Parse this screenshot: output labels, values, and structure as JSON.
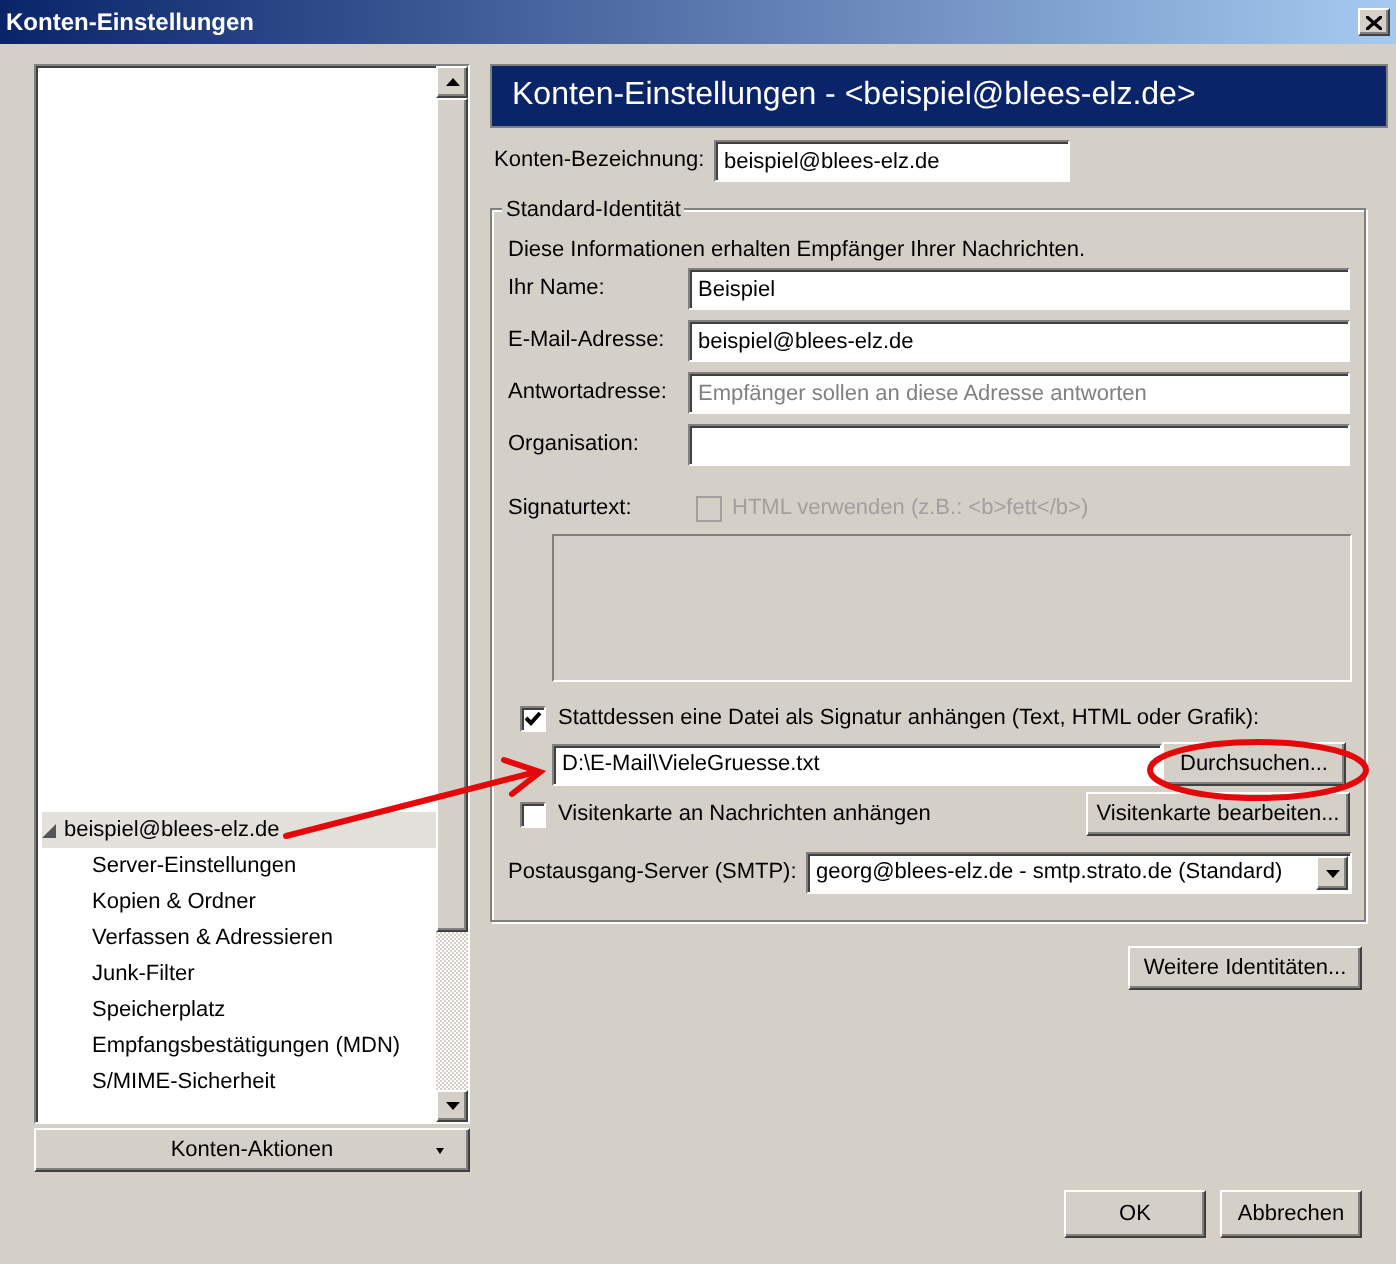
{
  "window": {
    "title": "Konten-Einstellungen"
  },
  "tree": {
    "items": [
      {
        "label": "beispiel@blees-elz.de",
        "selected": true,
        "expanded": true,
        "children": [
          {
            "label": "Server-Einstellungen",
            "selected": false
          },
          {
            "label": "Kopien & Ordner",
            "selected": false
          },
          {
            "label": "Verfassen & Adressieren",
            "selected": false
          },
          {
            "label": "Junk-Filter",
            "selected": false
          },
          {
            "label": "Speicherplatz",
            "selected": false
          },
          {
            "label": "Empfangsbestätigungen (MDN)",
            "selected": false
          },
          {
            "label": "S/MIME-Sicherheit",
            "selected": false
          }
        ]
      }
    ]
  },
  "account_actions_button": "Konten-Aktionen",
  "header": "Konten-Einstellungen - <beispiel@blees-elz.de>",
  "account_name": {
    "label": "Konten-Bezeichnung:",
    "value": "beispiel@blees-elz.de"
  },
  "identity": {
    "legend": "Standard-Identität",
    "description": "Diese Informationen erhalten Empfänger Ihrer Nachrichten.",
    "fields": [
      {
        "label": "Ihr Name:",
        "value": "Beispiel"
      },
      {
        "label": "E-Mail-Adresse:",
        "value": "beispiel@blees-elz.de"
      },
      {
        "label": "Antwortadresse:",
        "placeholder": "Empfänger sollen an diese Adresse antworten"
      },
      {
        "label": "Organisation:"
      }
    ],
    "signature_label": "Signaturtext:",
    "html_checkbox": {
      "label": "HTML verwenden (z.B.: <b>fett</b>)",
      "checked": false,
      "disabled": true
    },
    "file_checkbox": {
      "label": "Stattdessen eine Datei als Signatur anhängen (Text, HTML oder Grafik):",
      "checked": true
    },
    "file_path": "D:\\E-Mail\\VieleGruesse.txt",
    "browse_button": "Durchsuchen...",
    "vcard_checkbox": {
      "label": "Visitenkarte an Nachrichten anhängen",
      "checked": false
    },
    "vcard_button": "Visitenkarte bearbeiten...",
    "smtp": {
      "label": "Postausgang-Server (SMTP):",
      "value": "georg@blees-elz.de - smtp.strato.de (Standard)"
    }
  },
  "more_identities_button": "Weitere Identitäten...",
  "buttons": [
    "OK",
    "Abbrechen"
  ]
}
